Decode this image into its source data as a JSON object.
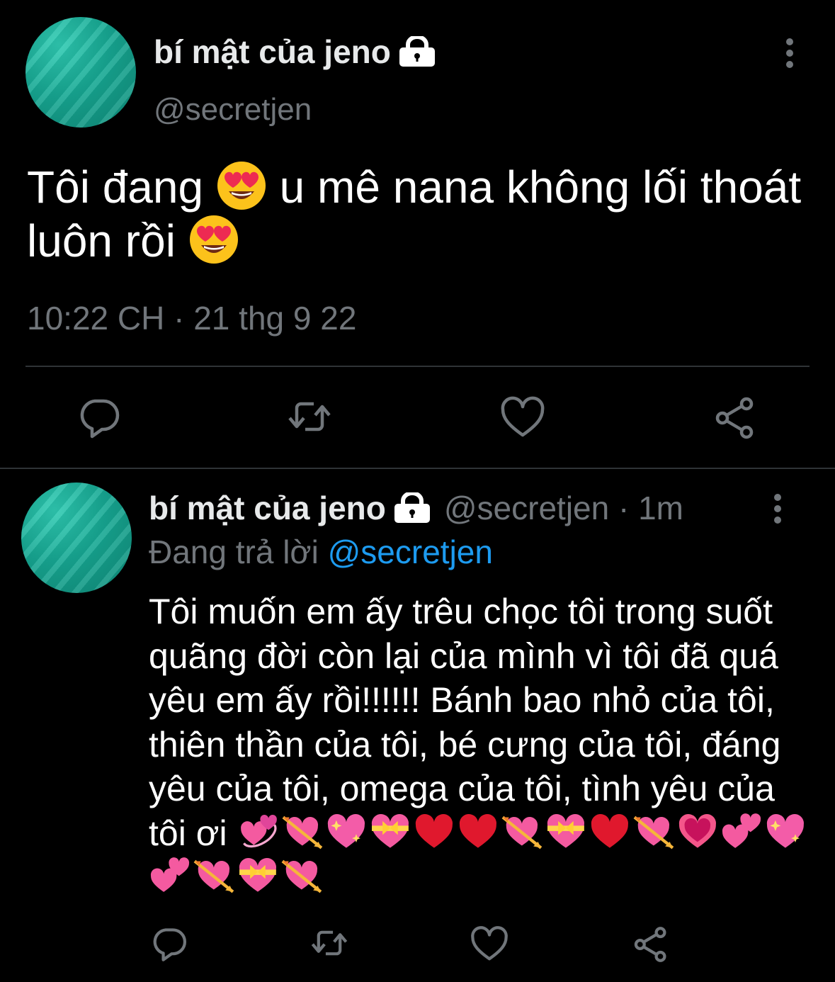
{
  "main_tweet": {
    "display_name": "bí mật của jeno",
    "handle": "@secretjen",
    "text_part1": "Tôi đang ",
    "text_part2": " u mê nana không lối thoát luôn rồi ",
    "timestamp": "10:22 CH · 21 thg 9 22",
    "icons": {
      "lock": "lock-icon",
      "more": "more-vertical-icon",
      "emoji": "heart-eyes-emoji"
    },
    "actions": [
      "reply-icon",
      "retweet-icon",
      "like-icon",
      "share-icon"
    ]
  },
  "reply_tweet": {
    "display_name": "bí mật của jeno",
    "handle_time": "@secretjen · 1m",
    "replying_label": "Đang trả lời ",
    "replying_handle": "@secretjen",
    "text": "Tôi muốn em ấy trêu chọc tôi trong suốt quãng đời còn lại của mình vì tôi đã quá yêu em ấy rồi!!!!!! Bánh bao nhỏ của tôi, thiên thần của tôi, bé cưng của tôi, đáng yêu của tôi, omega của tôi, tình yêu của tôi ơi ",
    "emoji_sequence": [
      "revolving-hearts",
      "heart-with-arrow",
      "sparkling-heart",
      "heart-with-ribbon",
      "red-heart",
      "red-heart",
      "heart-with-arrow",
      "heart-with-ribbon",
      "red-heart",
      "heart-with-arrow",
      "beating-heart",
      "two-hearts",
      "sparkling-heart",
      "two-hearts",
      "heart-with-arrow",
      "heart-with-ribbon",
      "heart-with-arrow"
    ],
    "actions": [
      "reply-icon",
      "retweet-icon",
      "like-icon",
      "share-icon"
    ]
  },
  "colors": {
    "background": "#000000",
    "primary_text": "#e7e9ea",
    "secondary_text": "#71767b",
    "link": "#1d9bf0",
    "divider": "#2f3336",
    "avatar": "#17a994"
  }
}
